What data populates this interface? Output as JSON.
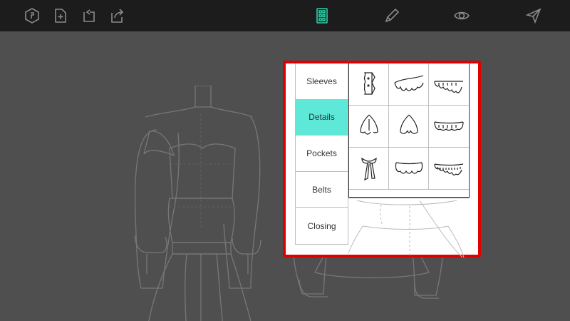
{
  "toolbar": {
    "left_icons": [
      "logo-hexagon-icon",
      "new-document-icon",
      "undo-icon",
      "share-icon"
    ],
    "right_icons": [
      "library-grid-icon",
      "pencil-icon",
      "eye-icon",
      "send-icon"
    ],
    "accent_color": "#2ecfa7"
  },
  "panel": {
    "highlight_color": "#e00000",
    "active_color": "#5ee8d8",
    "categories": [
      {
        "label": "Sleeves",
        "active": false
      },
      {
        "label": "Details",
        "active": true
      },
      {
        "label": "Pockets",
        "active": false
      },
      {
        "label": "Belts",
        "active": false
      },
      {
        "label": "Closing",
        "active": false
      }
    ],
    "items": [
      "ruffled-placket-icon",
      "ruffle-collar-icon",
      "ruffle-trim-icon",
      "pointed-collar-icon",
      "pointed-collar-alt-icon",
      "frill-trim-icon",
      "neck-bow-icon",
      "ruffle-peplum-icon",
      "fringe-trim-icon"
    ]
  }
}
